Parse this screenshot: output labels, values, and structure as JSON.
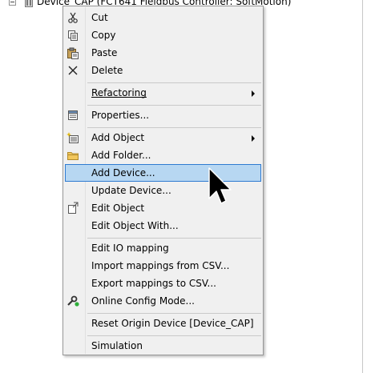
{
  "tree": {
    "device_label": "Device_CAP (FCT641 Fieldbus Controller: SoftMotion)"
  },
  "context_menu": {
    "items": [
      {
        "label": "Cut",
        "icon": "scissors-icon"
      },
      {
        "label": "Copy",
        "icon": "copy-icon"
      },
      {
        "label": "Paste",
        "icon": "paste-icon"
      },
      {
        "label": "Delete",
        "icon": "delete-x-icon"
      },
      {
        "label": "Refactoring",
        "submenu": true,
        "mnemonic": "R"
      },
      {
        "label": "Properties...",
        "icon": "properties-icon"
      },
      {
        "label": "Add Object",
        "icon": "add-object-icon",
        "submenu": true
      },
      {
        "label": "Add Folder...",
        "icon": "folder-icon"
      },
      {
        "label": "Add Device...",
        "selected": true
      },
      {
        "label": "Update Device..."
      },
      {
        "label": "Edit Object",
        "icon": "edit-object-icon"
      },
      {
        "label": "Edit Object With..."
      },
      {
        "label": "Edit IO mapping"
      },
      {
        "label": "Import mappings from CSV..."
      },
      {
        "label": "Export mappings to CSV..."
      },
      {
        "label": "Online Config Mode...",
        "icon": "online-config-icon"
      },
      {
        "label": "Reset Origin Device [Device_CAP]"
      },
      {
        "label": "Simulation"
      }
    ]
  },
  "colors": {
    "menu_background": "#f0f0f0",
    "selection_fill": "#b7d7f2",
    "selection_border": "#2f7bd1",
    "separator": "#c9c9c9"
  }
}
